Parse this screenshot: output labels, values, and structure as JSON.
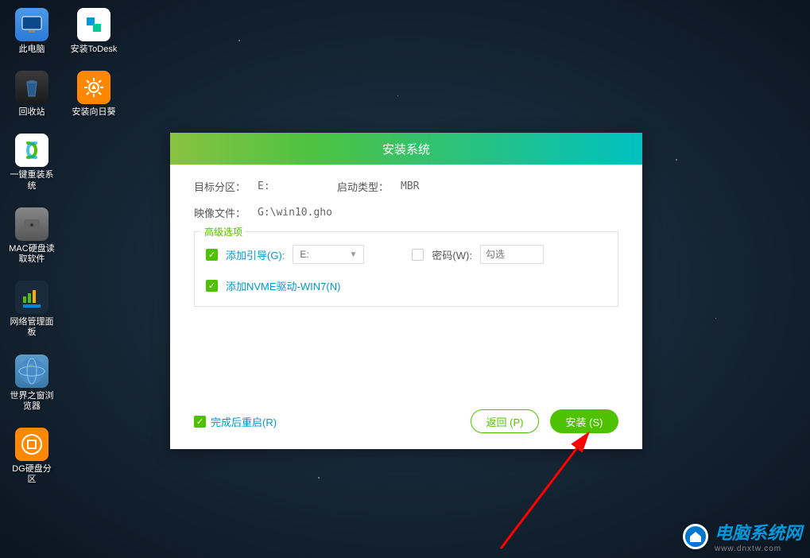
{
  "desktop": {
    "icons": [
      {
        "label": "此电脑"
      },
      {
        "label": "安装ToDesk"
      },
      {
        "label": "回收站"
      },
      {
        "label": "安装向日葵"
      },
      {
        "label": "一键重装系统"
      },
      {
        "label": "MAC硬盘读取软件"
      },
      {
        "label": "网络管理面板"
      },
      {
        "label": "世界之窗浏览器"
      },
      {
        "label": "DG硬盘分区"
      }
    ]
  },
  "dialog": {
    "title": "安装系统",
    "target_partition_label": "目标分区：",
    "target_partition_value": "E:",
    "boot_type_label": "启动类型：",
    "boot_type_value": "MBR",
    "image_file_label": "映像文件：",
    "image_file_value": "G:\\win10.gho",
    "advanced": {
      "legend": "高级选项",
      "add_boot_label": "添加引导(G):",
      "add_boot_value": "E:",
      "password_label": "密码(W):",
      "password_placeholder": "勾选",
      "nvme_label": "添加NVME驱动-WIN7(N)"
    },
    "restart_label": "完成后重启(R)",
    "back_button": "返回 (P)",
    "install_button": "安装 (S)"
  },
  "watermark": {
    "title": "电脑系统网",
    "url": "www.dnxtw.com"
  }
}
